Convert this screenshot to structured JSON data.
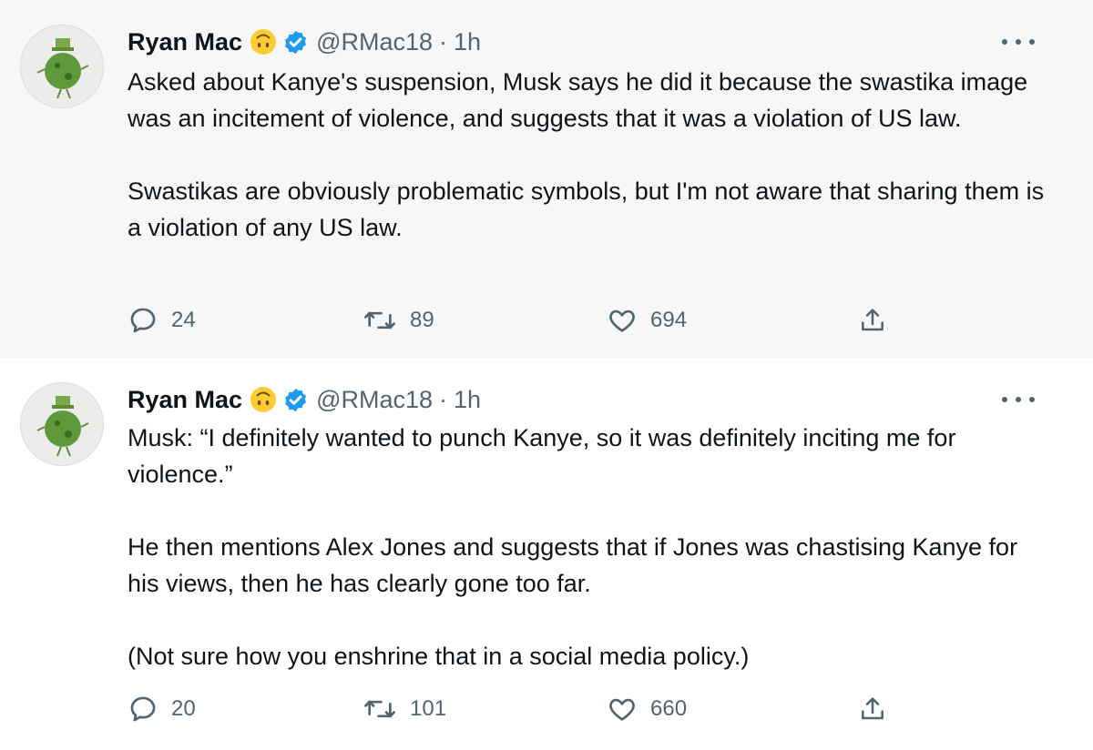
{
  "tweets": [
    {
      "author_name": "Ryan Mac",
      "handle": "@RMac18",
      "separator": "·",
      "time": "1h",
      "paragraphs": [
        "Asked about Kanye's suspension, Musk says he did it because the swastika image was an incitement of violence, and suggests that it was a violation of US law.",
        "Swastikas are obviously problematic symbols, but I'm not aware that sharing them is a violation of any US law."
      ],
      "replies": "24",
      "retweets": "89",
      "likes": "694"
    },
    {
      "author_name": "Ryan Mac",
      "handle": "@RMac18",
      "separator": "·",
      "time": "1h",
      "paragraphs": [
        "Musk: “I definitely wanted to punch Kanye, so it was definitely inciting me for violence.”",
        "He then mentions Alex Jones and suggests that if Jones was chastising Kanye for his views, then he has clearly gone too far.",
        "(Not sure how you enshrine that in a social media policy.)"
      ],
      "replies": "20",
      "retweets": "101",
      "likes": "660"
    }
  ],
  "icons": {
    "emoji": "upside-down-face-emoji",
    "verified": "verified-badge-icon",
    "more": "more-options-icon",
    "reply": "reply-icon",
    "retweet": "retweet-icon",
    "like": "like-icon",
    "share": "share-icon"
  },
  "colors": {
    "verified_blue": "#1d9bf0",
    "secondary_text": "#536471",
    "highlight_background": "#f7f7f7"
  }
}
